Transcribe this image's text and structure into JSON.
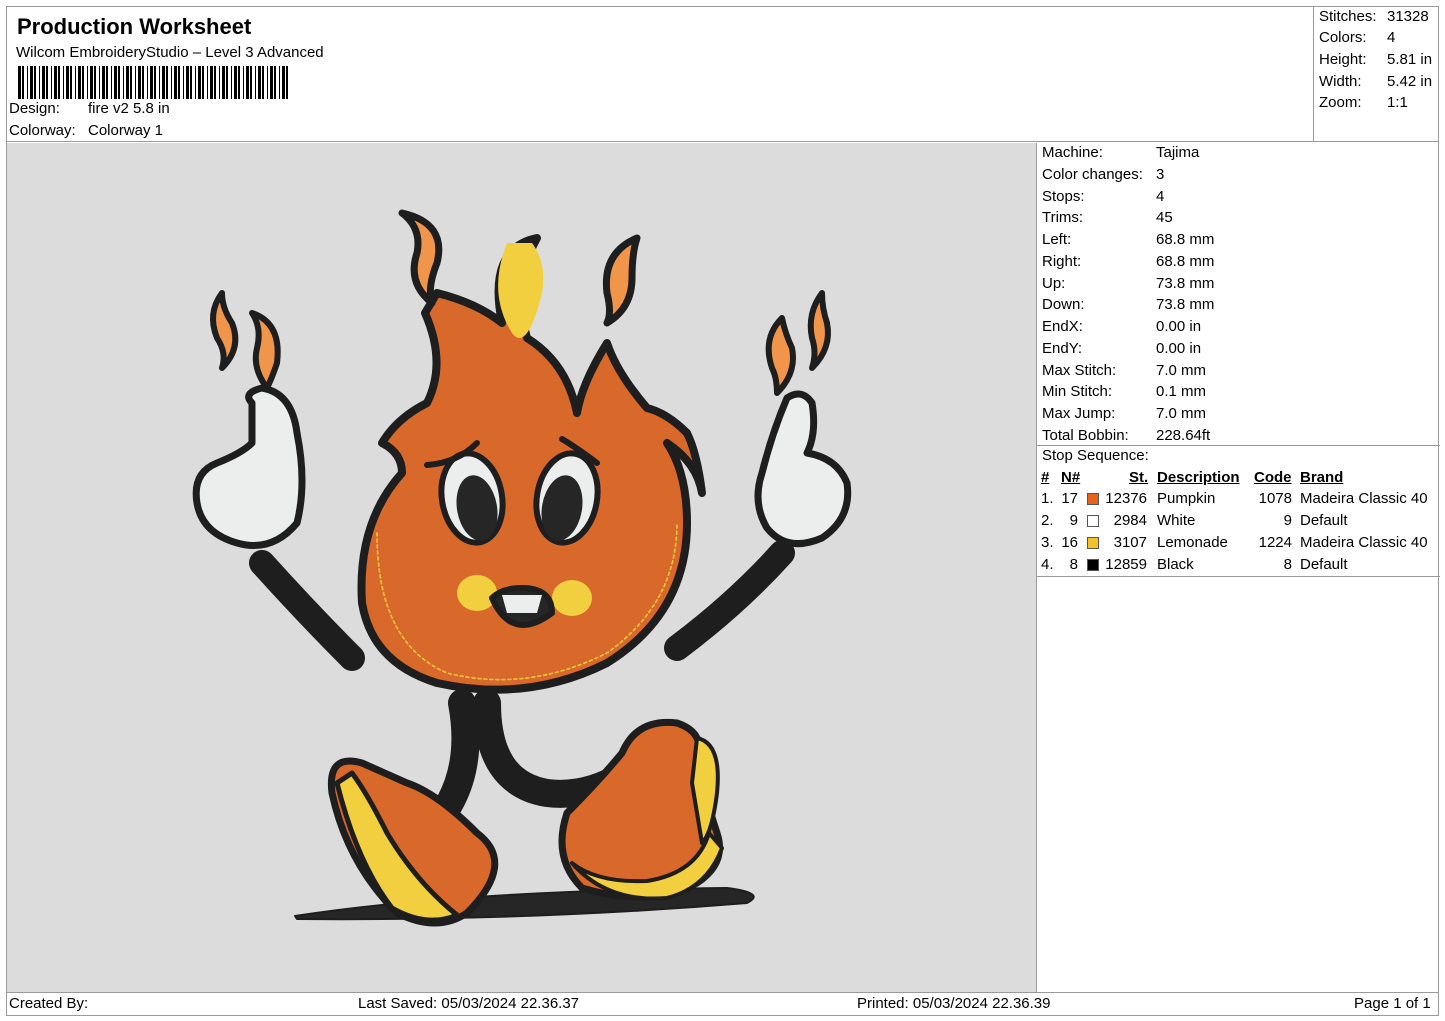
{
  "header": {
    "title": "Production Worksheet",
    "subtitle": "Wilcom EmbroideryStudio – Level 3 Advanced",
    "design_label": "Design:",
    "design_value": "fire v2 5.8 in",
    "colorway_label": "Colorway:",
    "colorway_value": "Colorway 1"
  },
  "stats": {
    "stitches_label": "Stitches:",
    "stitches": "31328",
    "colors_label": "Colors:",
    "colors": "4",
    "height_label": "Height:",
    "height": "5.81 in",
    "width_label": "Width:",
    "width": "5.42 in",
    "zoom_label": "Zoom:",
    "zoom": "1:1"
  },
  "machine": [
    {
      "label": "Machine:",
      "value": "Tajima"
    },
    {
      "label": "Color changes:",
      "value": "3"
    },
    {
      "label": "Stops:",
      "value": "4"
    },
    {
      "label": "Trims:",
      "value": "45"
    },
    {
      "label": "Left:",
      "value": "68.8 mm"
    },
    {
      "label": "Right:",
      "value": "68.8 mm"
    },
    {
      "label": "Up:",
      "value": "73.8 mm"
    },
    {
      "label": "Down:",
      "value": "73.8 mm"
    },
    {
      "label": "EndX:",
      "value": "0.00 in"
    },
    {
      "label": "EndY:",
      "value": "0.00 in"
    },
    {
      "label": "Max Stitch:",
      "value": "7.0 mm"
    },
    {
      "label": "Min Stitch:",
      "value": "0.1 mm"
    },
    {
      "label": "Max Jump:",
      "value": "7.0 mm"
    },
    {
      "label": "Total Bobbin:",
      "value": "228.64ft"
    }
  ],
  "stop_sequence": {
    "title": "Stop Sequence:",
    "headers": {
      "num": "#",
      "n": "N#",
      "st": "St.",
      "desc": "Description",
      "code": "Code",
      "brand": "Brand"
    },
    "rows": [
      {
        "num": "1.",
        "n": "17",
        "color": "#e8621c",
        "st": "12376",
        "desc": "Pumpkin",
        "code": "1078",
        "brand": "Madeira Classic 40"
      },
      {
        "num": "2.",
        "n": "9",
        "color": "#ffffff",
        "st": "2984",
        "desc": "White",
        "code": "9",
        "brand": "Default"
      },
      {
        "num": "3.",
        "n": "16",
        "color": "#f5c02a",
        "st": "3107",
        "desc": "Lemonade",
        "code": "1224",
        "brand": "Madeira Classic 40"
      },
      {
        "num": "4.",
        "n": "8",
        "color": "#000000",
        "st": "12859",
        "desc": "Black",
        "code": "8",
        "brand": "Default"
      }
    ]
  },
  "footer": {
    "created_by": "Created By:",
    "last_saved": "Last Saved: 05/03/2024 22.36.37",
    "printed": "Printed: 05/03/2024 22.36.39",
    "page": "Page 1 of 1"
  },
  "colors": {
    "orange": "#d9692a",
    "orange_light": "#f0954a",
    "yellow": "#f2cf3e",
    "black": "#1e1e1e",
    "white": "#eceeee",
    "preview_bg": "#dcdcdc"
  }
}
